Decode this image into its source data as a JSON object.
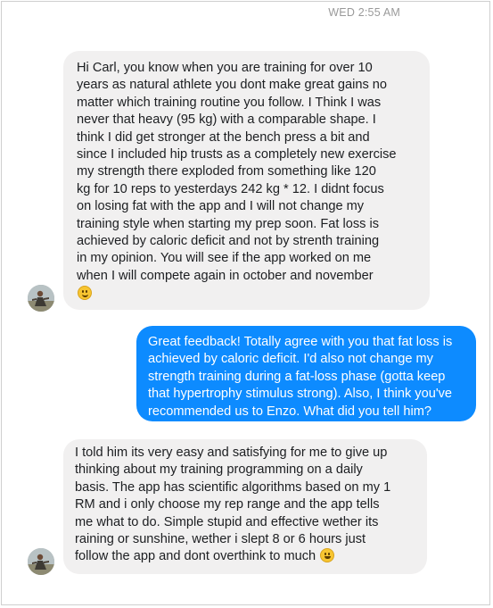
{
  "conversation": {
    "timestamp": "WED 2:55 AM",
    "messages": [
      {
        "direction": "incoming",
        "text": "Hi Carl, you know when you are training for over 10\nyears as natural athlete you dont make great gains no\nmatter which training routine you follow. I Think I was\nnever that heavy (95 kg) with a comparable shape. I\nthink I did get stronger at the bench press a bit and\nsince I included hip trusts as a completely new exercise\nmy strength there exploded from something like 120\nkg for 10 reps to yesterdays 242 kg * 12. I didnt focus\non losing fat with the app and I will not change my\ntraining style when starting my prep soon. Fat loss is\nachieved by caloric deficit and not by strenth training\nin my opinion. You will see if the app worked on me\nwhen I will compete again in october and november",
        "emoji": "smiling-face-emoji"
      },
      {
        "direction": "outgoing",
        "text": "Great feedback! Totally agree with you that fat loss is\nachieved by caloric deficit. I'd also not change my\nstrength training during a fat-loss phase (gotta keep\nthat hypertrophy stimulus strong). Also, I think you've\nrecommended us to Enzo. What did you tell him?"
      },
      {
        "direction": "incoming",
        "text": "I told him its very easy and satisfying for me to give up\nthinking about my training programming on a daily\nbasis. The app has scientific algorithms based on my 1\nRM and i only choose my rep range and the app tells\nme what to do. Simple stupid and effective wether its\nraining or sunshine, wether i slept 8 or 6 hours just\nfollow the app and dont overthink to much",
        "emoji": "grinning-face-emoji"
      }
    ]
  },
  "colors": {
    "incoming_bubble": "#f1f0f0",
    "outgoing_bubble": "#0d8bff",
    "timestamp": "#9a9a9a"
  }
}
